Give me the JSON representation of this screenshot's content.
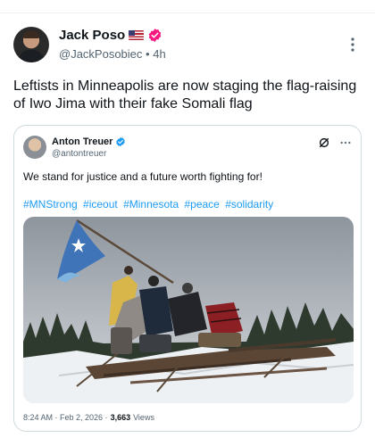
{
  "post": {
    "author": {
      "display_name": "Jack Poso",
      "flag_icon": "us-flag-icon",
      "badge_icon": "verified-badge-icon",
      "badge_color": "#f91880",
      "handle": "@JackPosobiec",
      "separator": "•",
      "time": "4h"
    },
    "more_icon": "more-vertical-icon",
    "text": "Leftists in Minneapolis are now staging the flag-raising of Iwo Jima with their fake Somali flag"
  },
  "quote": {
    "author": {
      "display_name": "Anton Treuer",
      "handle": "@antontreuer",
      "badge_color": "#1d9bf0"
    },
    "text": "We stand for justice and a future worth fighting for!",
    "hashtags": [
      "#MNStrong",
      "#iceout",
      "#Minnesota",
      "#peace",
      "#solidarity"
    ],
    "timestamp": "8:24 AM · Feb 2, 2026 ·",
    "views_count": "3,663",
    "views_label": "Views",
    "icons": [
      "grok-icon",
      "more-horizontal-icon"
    ]
  },
  "colors": {
    "text_primary": "#0f1419",
    "text_secondary": "#536471",
    "link": "#1d9bf0",
    "border": "#cfd9de"
  }
}
